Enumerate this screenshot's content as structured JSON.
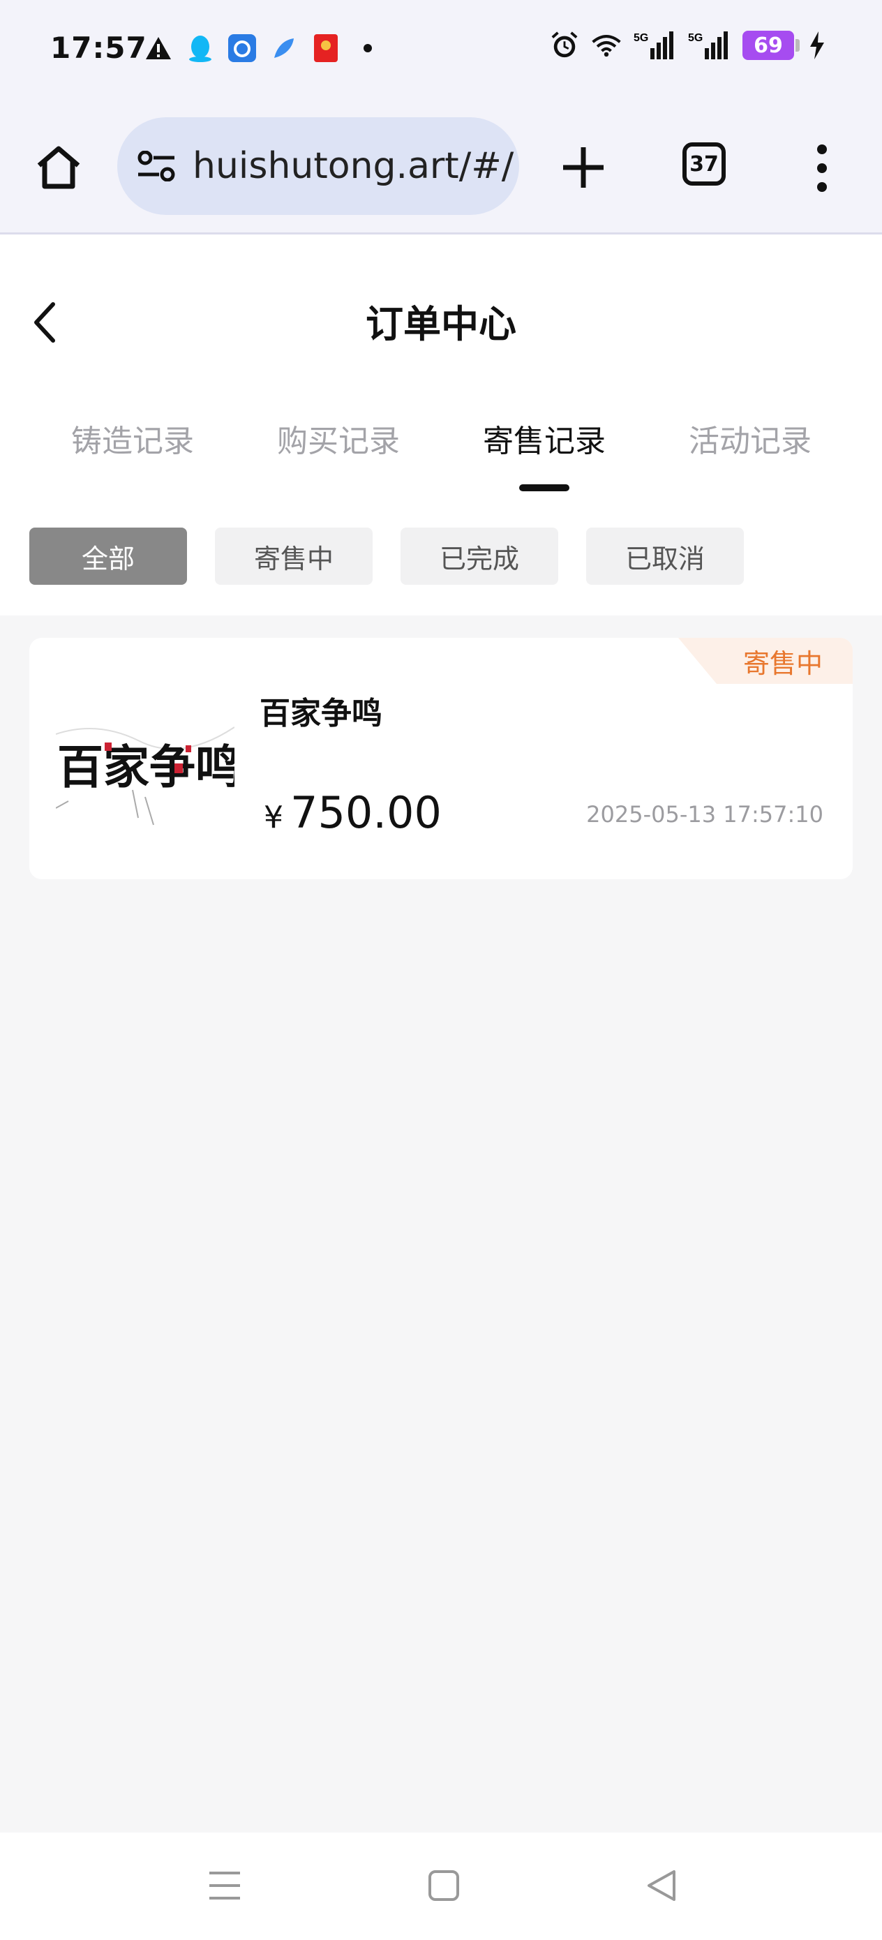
{
  "status_bar": {
    "time": "17:57",
    "battery": "69",
    "icons": [
      "warning-icon",
      "qq-icon",
      "app-icon",
      "feather-icon",
      "red-packet-icon",
      "dot-icon",
      "alarm-icon",
      "wifi-icon",
      "signal-5g-icon",
      "signal-5g-icon",
      "charging-icon"
    ]
  },
  "browser": {
    "url": "huishutong.art/#/",
    "tab_count": "37"
  },
  "header": {
    "title": "订单中心"
  },
  "tabs": [
    {
      "label": "铸造记录",
      "active": false
    },
    {
      "label": "购买记录",
      "active": false
    },
    {
      "label": "寄售记录",
      "active": true
    },
    {
      "label": "活动记录",
      "active": false
    }
  ],
  "filters": [
    {
      "label": "全部",
      "active": true
    },
    {
      "label": "寄售中",
      "active": false
    },
    {
      "label": "已完成",
      "active": false
    },
    {
      "label": "已取消",
      "active": false
    }
  ],
  "orders": [
    {
      "name": "百家争鸣",
      "status": "寄售中",
      "currency": "¥",
      "price": "750.00",
      "time": "2025-05-13 17:57:10",
      "thumbnail_text": "百家争鸣"
    }
  ],
  "colors": {
    "status_text": "#e8772e",
    "status_bg": "#fdf0e8",
    "active_chip": "#888888",
    "page_bg": "#f6f6f7"
  }
}
